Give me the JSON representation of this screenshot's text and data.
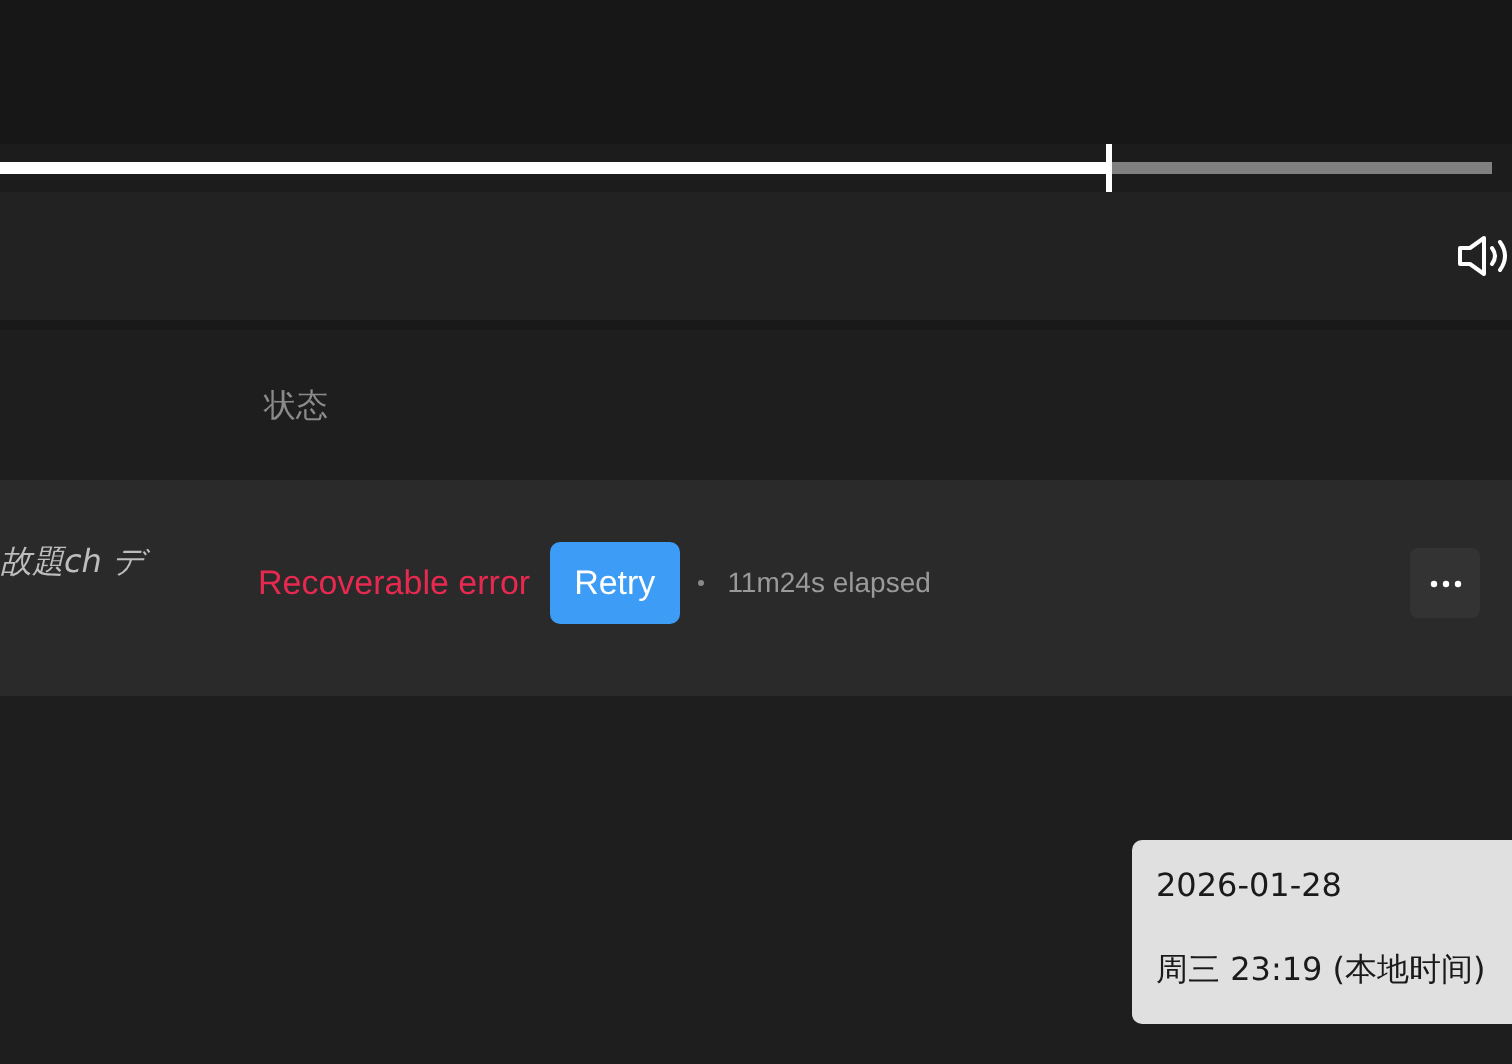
{
  "player": {
    "progress": {
      "level": 0.743
    }
  },
  "table": {
    "columns": [
      "状态"
    ],
    "rows": [
      {
        "title": "故題ch デ",
        "status": {
          "text": "Recoverable error",
          "color": "#e8294f"
        },
        "action": "Retry",
        "elapsed": "11m24s elapsed"
      }
    ]
  },
  "tooltip": {
    "lines": [
      "2026-01-28",
      "周三 23:19 (本地时间)"
    ]
  }
}
